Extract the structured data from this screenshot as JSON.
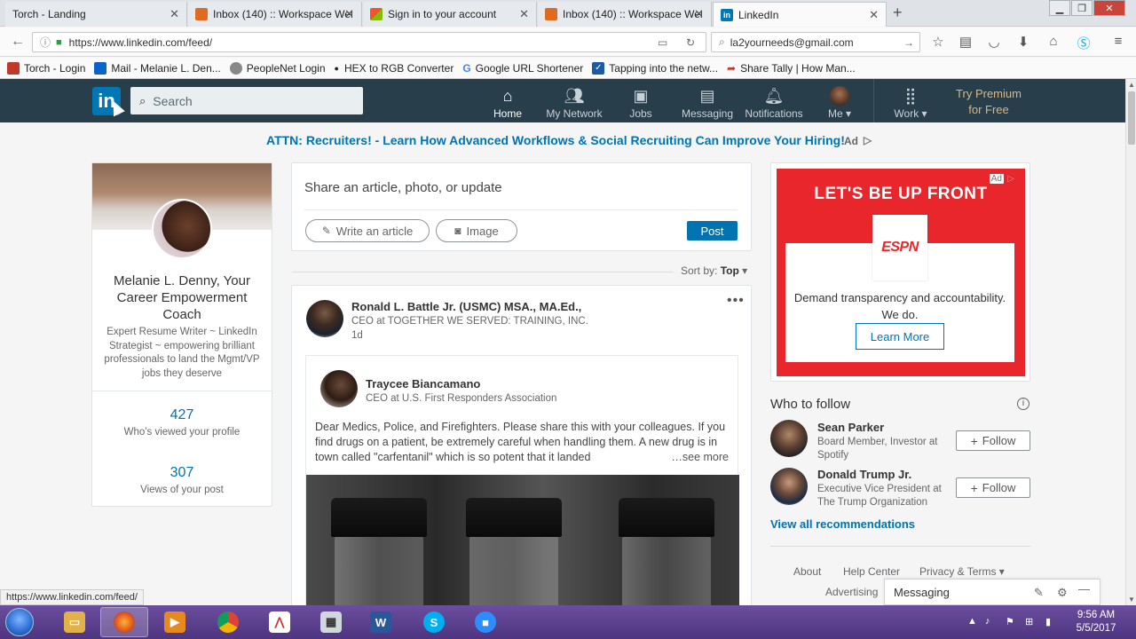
{
  "browser": {
    "tabs": [
      {
        "label": "Torch - Landing",
        "favicon_color": "#dfe3e8"
      },
      {
        "label": "Inbox (140) :: Workspace Wel",
        "favicon_color": "#e06a1f"
      },
      {
        "label": "Sign in to your account",
        "favicon_color": "#f35325"
      },
      {
        "label": "Inbox (140) :: Workspace Wel",
        "favicon_color": "#e06a1f"
      },
      {
        "label": "LinkedIn",
        "favicon_color": "#0077b5"
      }
    ],
    "url": "https://www.linkedin.com/feed/",
    "search_value": "la2yourneeds@gmail.com",
    "bookmarks": [
      {
        "label": "Torch - Login",
        "favicon_color": "#c0392b"
      },
      {
        "label": "Mail - Melanie L. Den...",
        "favicon_color": "#0a64c8"
      },
      {
        "label": "PeopleNet Login",
        "favicon_color": "#888888"
      },
      {
        "label": "HEX to RGB Converter",
        "favicon_color": "#222222"
      },
      {
        "label": "Google URL Shortener",
        "favicon_color": "#4285f4"
      },
      {
        "label": "Tapping into the netw...",
        "favicon_color": "#1c5aa6"
      },
      {
        "label": "Share Tally | How Man...",
        "favicon_color": "#c0392b"
      }
    ],
    "status_url": "https://www.linkedin.com/feed/"
  },
  "linkedin": {
    "logo_text": "in",
    "search_placeholder": "Search",
    "nav": [
      {
        "label": "Home",
        "icon": "home-icon"
      },
      {
        "label": "My Network",
        "icon": "people-icon"
      },
      {
        "label": "Jobs",
        "icon": "briefcase-icon"
      },
      {
        "label": "Messaging",
        "icon": "chat-icon"
      },
      {
        "label": "Notifications",
        "icon": "bell-icon"
      },
      {
        "label": "Me ▾",
        "icon": "avatar"
      },
      {
        "label": "Work ▾",
        "icon": "grid-icon"
      }
    ],
    "premium_line1": "Try Premium",
    "premium_line2": "for Free",
    "ad_banner": "ATTN: Recruiters! - Learn How Advanced Workflows & Social Recruiting Can Improve Your Hiring!",
    "ad_tag": "Ad",
    "brand_color": "#0073b1",
    "header_color": "#283e4a"
  },
  "profile": {
    "name": "Melanie L. Denny, Your Career Empowerment Coach",
    "headline": "Expert Resume Writer ~ LinkedIn Strategist ~ empowering brilliant professionals to land the Mgmt/VP jobs they deserve",
    "stats": [
      {
        "value": "427",
        "label": "Who's viewed your profile"
      },
      {
        "value": "307",
        "label": "Views of your post"
      }
    ]
  },
  "share": {
    "prompt": "Share an article, photo, or update",
    "write_article": "Write an article",
    "image": "Image",
    "post": "Post"
  },
  "sort": {
    "label": "Sort by:",
    "value": "Top"
  },
  "post": {
    "author": "Ronald L. Battle Jr. (USMC) MSA., MA.Ed.,",
    "author_title": "CEO at TOGETHER WE SERVED: TRAINING, INC.",
    "time": "1d",
    "shared": {
      "author": "Traycee Biancamano",
      "author_title": "CEO at U.S. First Responders Association",
      "text": "Dear Medics, Police, and Firefighters. Please share this with your colleagues. If you find drugs on a patient, be extremely careful when handling them. A new drug is in town called \"carfentanil\" which is so potent that it landed",
      "see_more": "…see more"
    }
  },
  "right_ad": {
    "headline": "LET'S BE UP FRONT",
    "logo": "ESPN",
    "copy": "Demand transparency and accountability. We do.",
    "cta": "Learn More",
    "badge": "Ad",
    "bg_color": "#e8262b"
  },
  "who_to_follow": {
    "title": "Who to follow",
    "people": [
      {
        "name": "Sean Parker",
        "desc": "Board Member, Investor at Spotify",
        "button": "Follow"
      },
      {
        "name": "Donald Trump Jr.",
        "desc": "Executive Vice President at The Trump Organization",
        "button": "Follow"
      }
    ],
    "view_all": "View all recommendations"
  },
  "footer_links": {
    "about": "About",
    "help": "Help Center",
    "privacy": "Privacy & Terms ▾",
    "advertising": "Advertising"
  },
  "messaging_dock": {
    "label": "Messaging"
  },
  "taskbar": {
    "time": "9:56 AM",
    "date": "5/5/2017"
  }
}
